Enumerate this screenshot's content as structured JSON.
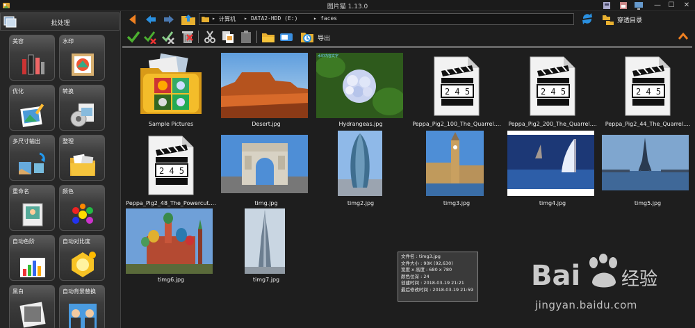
{
  "window": {
    "title": "图片猫 1.13.0"
  },
  "sidebar": {
    "header": "批处理",
    "tools": [
      {
        "label": "美容",
        "icon": "cosmetics-icon"
      },
      {
        "label": "水印",
        "icon": "stamp-icon"
      },
      {
        "label": "优化",
        "icon": "photo-brush-icon"
      },
      {
        "label": "转换",
        "icon": "convert-icon"
      },
      {
        "label": "多尺寸输出",
        "icon": "multi-size-icon"
      },
      {
        "label": "整理",
        "icon": "folder-photos-icon"
      },
      {
        "label": "重命名",
        "icon": "rename-icon"
      },
      {
        "label": "颜色",
        "icon": "color-dots-icon"
      },
      {
        "label": "自动色阶",
        "icon": "histogram-icon"
      },
      {
        "label": "自动对比度",
        "icon": "contrast-icon"
      },
      {
        "label": "黑白",
        "icon": "black-white-icon"
      },
      {
        "label": "自动背景替换",
        "icon": "background-replace-icon"
      }
    ]
  },
  "address": {
    "crumbs": [
      "计算机",
      "DATA2-HDD (E:)",
      "faces"
    ],
    "separator": "▸"
  },
  "goto_dir_label": "穿透目录",
  "toolbar": {
    "export_label": "导出"
  },
  "files": [
    {
      "name": "Sample Pictures",
      "kind": "folder"
    },
    {
      "name": "Desert.jpg",
      "kind": "desert"
    },
    {
      "name": "Hydrangeas.jpg",
      "kind": "flower",
      "overlay": "水印内容文字"
    },
    {
      "name": "Peppa_Pig2_100_The_Quarrel....",
      "kind": "video"
    },
    {
      "name": "Peppa_Pig2_200_The_Quarrel....",
      "kind": "video"
    },
    {
      "name": "Peppa_Pig2_44_The_Quarrel....",
      "kind": "video"
    },
    {
      "name": "Peppa_Pig2_48_The_Powercut....",
      "kind": "video"
    },
    {
      "name": "timg.jpg",
      "kind": "arch"
    },
    {
      "name": "timg2.jpg",
      "kind": "gherkin"
    },
    {
      "name": "timg3.jpg",
      "kind": "bigben"
    },
    {
      "name": "timg4.jpg",
      "kind": "burj-al-arab"
    },
    {
      "name": "timg5.jpg",
      "kind": "eiffel"
    },
    {
      "name": "timg6.jpg",
      "kind": "basil"
    },
    {
      "name": "timg7.jpg",
      "kind": "burj-khalifa"
    }
  ],
  "clip_digits": "2 4 5",
  "tooltip": {
    "lines": [
      "文件名 : timg3.jpg",
      "文件大小 : 90K (92,630)",
      "宽度 x 高度 : 680 x 780",
      "颜色位深 : 24",
      "创建时间 : 2018-03-19 21:21",
      "最后修改时间 : 2018-03-19 21:59"
    ]
  },
  "watermark": {
    "logo_text": "Bai du 经验",
    "url": "jingyan.baidu.com"
  },
  "colors": {
    "background": "#1e1e1e",
    "sidebar": "#262626",
    "accent_orange": "#f08020",
    "check_green": "#4caf30"
  }
}
